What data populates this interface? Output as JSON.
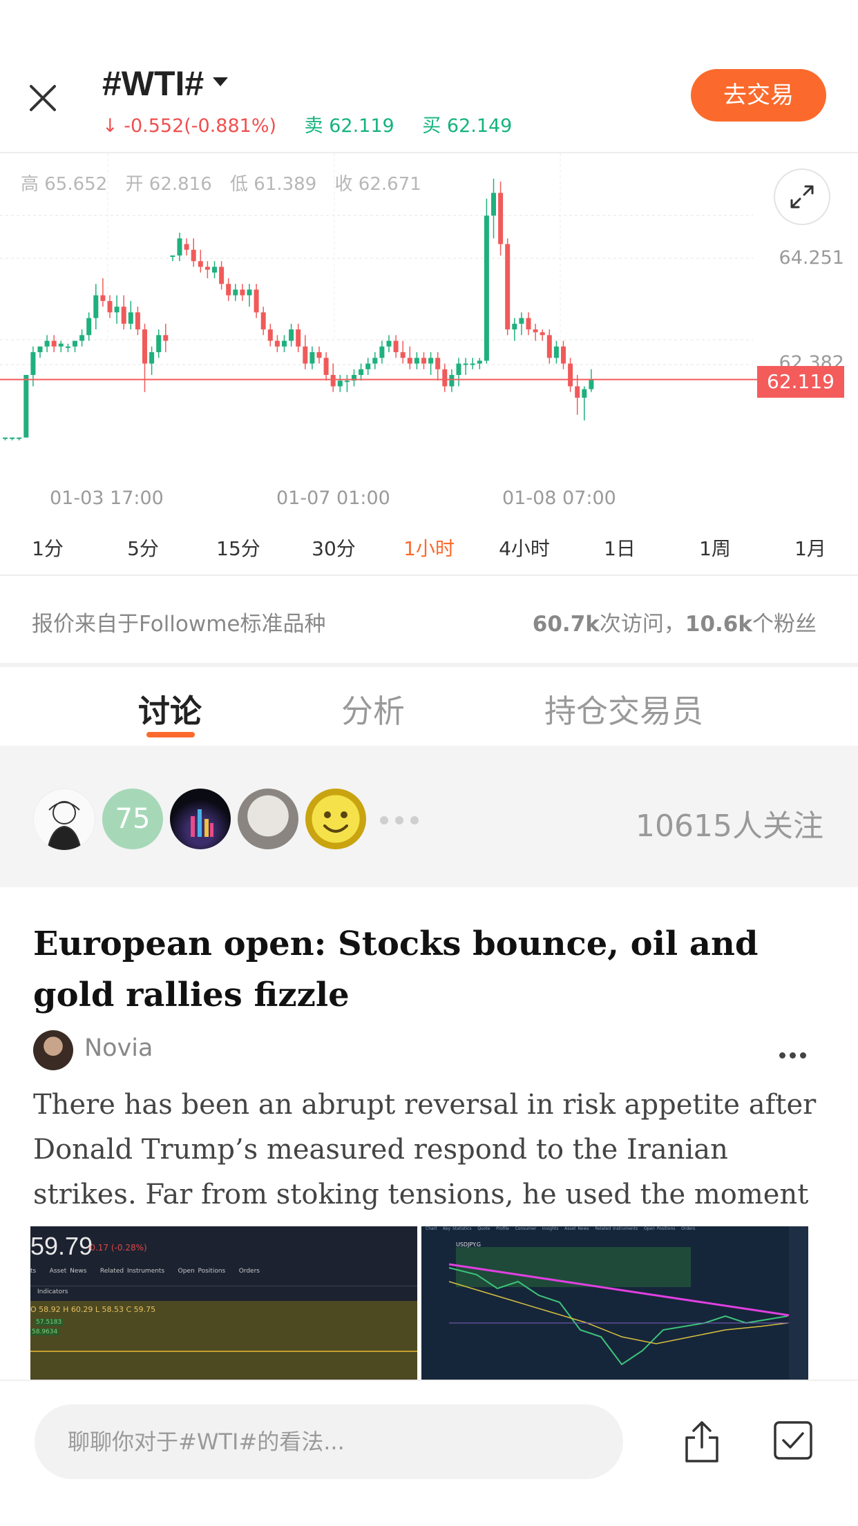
{
  "header": {
    "title": "#WTI#",
    "change": "-0.552(-0.881%)",
    "sell_label": "卖",
    "sell_price": "62.119",
    "buy_label": "买",
    "buy_price": "62.149",
    "trade_button": "去交易",
    "colors": {
      "down": "#f04f4f",
      "quote": "#14b37d",
      "accent": "#fb6a2c"
    }
  },
  "chart": {
    "ohlc": {
      "high": "高 65.652",
      "open": "开 62.816",
      "low": "低 61.389",
      "close": "收 62.671"
    },
    "price_labels": [
      "64.251",
      "62.382"
    ],
    "current_price": "62.119",
    "x_ticks": [
      "01-03 17:00",
      "01-07 01:00",
      "01-08 07:00"
    ]
  },
  "chart_data": {
    "type": "candlestick",
    "interval": "1小时",
    "y_ticks": [
      64.251,
      62.382
    ],
    "current_price": 62.119,
    "x_tick_labels": [
      "01-03 17:00",
      "01-07 01:00",
      "01-08 07:00"
    ],
    "candles": [
      [
        61.1,
        61.1,
        61.05,
        61.1
      ],
      [
        61.1,
        61.1,
        61.05,
        61.1
      ],
      [
        61.1,
        61.1,
        61.05,
        61.1
      ],
      [
        61.1,
        62.2,
        61.1,
        62.2
      ],
      [
        62.2,
        62.7,
        62.0,
        62.6
      ],
      [
        62.6,
        62.7,
        62.5,
        62.7
      ],
      [
        62.7,
        62.9,
        62.6,
        62.8
      ],
      [
        62.8,
        62.9,
        62.6,
        62.7
      ],
      [
        62.7,
        62.8,
        62.6,
        62.75
      ],
      [
        62.7,
        62.75,
        62.6,
        62.7
      ],
      [
        62.7,
        62.8,
        62.6,
        62.8
      ],
      [
        62.8,
        63.0,
        62.7,
        62.9
      ],
      [
        62.9,
        63.3,
        62.8,
        63.2
      ],
      [
        63.2,
        63.8,
        63.0,
        63.6
      ],
      [
        63.6,
        63.9,
        63.4,
        63.5
      ],
      [
        63.5,
        63.6,
        63.2,
        63.3
      ],
      [
        63.3,
        63.6,
        63.1,
        63.4
      ],
      [
        63.4,
        63.6,
        63.0,
        63.1
      ],
      [
        63.1,
        63.5,
        63.0,
        63.3
      ],
      [
        63.3,
        63.4,
        62.9,
        63.0
      ],
      [
        63.0,
        63.1,
        61.9,
        62.4
      ],
      [
        62.4,
        62.7,
        62.2,
        62.6
      ],
      [
        62.6,
        63.0,
        62.5,
        62.9
      ],
      [
        62.9,
        63.1,
        62.6,
        62.8
      ],
      [
        64.3,
        64.3,
        64.2,
        64.3
      ],
      [
        64.3,
        64.7,
        64.2,
        64.6
      ],
      [
        64.5,
        64.6,
        64.3,
        64.4
      ],
      [
        64.4,
        64.6,
        64.1,
        64.2
      ],
      [
        64.2,
        64.4,
        64.0,
        64.1
      ],
      [
        64.1,
        64.2,
        63.9,
        64.05
      ],
      [
        64.0,
        64.2,
        63.9,
        64.1
      ],
      [
        64.1,
        64.2,
        63.7,
        63.8
      ],
      [
        63.8,
        63.9,
        63.5,
        63.6
      ],
      [
        63.6,
        63.8,
        63.5,
        63.7
      ],
      [
        63.7,
        63.8,
        63.5,
        63.6
      ],
      [
        63.6,
        63.8,
        63.4,
        63.7
      ],
      [
        63.7,
        63.8,
        63.2,
        63.3
      ],
      [
        63.3,
        63.4,
        62.9,
        63.0
      ],
      [
        63.0,
        63.1,
        62.7,
        62.8
      ],
      [
        62.8,
        62.9,
        62.6,
        62.7
      ],
      [
        62.7,
        62.9,
        62.6,
        62.8
      ],
      [
        62.8,
        63.1,
        62.7,
        63.0
      ],
      [
        63.0,
        63.1,
        62.6,
        62.7
      ],
      [
        62.7,
        62.9,
        62.3,
        62.4
      ],
      [
        62.4,
        62.7,
        62.3,
        62.6
      ],
      [
        62.6,
        62.7,
        62.4,
        62.5
      ],
      [
        62.5,
        62.6,
        62.1,
        62.2
      ],
      [
        62.2,
        62.4,
        61.9,
        62.0
      ],
      [
        62.0,
        62.2,
        61.9,
        62.1
      ],
      [
        62.1,
        62.2,
        61.9,
        62.1
      ],
      [
        62.1,
        62.3,
        62.0,
        62.2
      ],
      [
        62.2,
        62.4,
        62.1,
        62.3
      ],
      [
        62.3,
        62.5,
        62.2,
        62.4
      ],
      [
        62.4,
        62.6,
        62.3,
        62.5
      ],
      [
        62.5,
        62.8,
        62.4,
        62.7
      ],
      [
        62.7,
        62.9,
        62.6,
        62.8
      ],
      [
        62.8,
        62.9,
        62.5,
        62.6
      ],
      [
        62.6,
        62.8,
        62.4,
        62.5
      ],
      [
        62.5,
        62.7,
        62.3,
        62.4
      ],
      [
        62.4,
        62.6,
        62.3,
        62.5
      ],
      [
        62.5,
        62.6,
        62.3,
        62.4
      ],
      [
        62.4,
        62.6,
        62.2,
        62.5
      ],
      [
        62.5,
        62.6,
        62.1,
        62.3
      ],
      [
        62.3,
        62.4,
        61.9,
        62.0
      ],
      [
        62.0,
        62.3,
        61.9,
        62.2
      ],
      [
        62.2,
        62.5,
        62.0,
        62.4
      ],
      [
        62.4,
        62.5,
        62.2,
        62.4
      ],
      [
        62.4,
        62.5,
        62.3,
        62.4
      ],
      [
        62.4,
        62.5,
        62.3,
        62.45
      ],
      [
        62.45,
        65.3,
        62.4,
        65.0
      ],
      [
        65.0,
        65.65,
        64.6,
        65.4
      ],
      [
        65.4,
        65.6,
        64.3,
        64.5
      ],
      [
        64.5,
        64.6,
        62.9,
        63.0
      ],
      [
        63.0,
        63.2,
        62.8,
        63.1
      ],
      [
        63.1,
        63.3,
        62.9,
        63.2
      ],
      [
        63.2,
        63.3,
        62.9,
        63.0
      ],
      [
        63.0,
        63.1,
        62.8,
        62.95
      ],
      [
        62.95,
        63.0,
        62.8,
        62.9
      ],
      [
        62.9,
        63.0,
        62.4,
        62.5
      ],
      [
        62.5,
        62.8,
        62.4,
        62.7
      ],
      [
        62.7,
        62.8,
        62.3,
        62.4
      ],
      [
        62.4,
        62.5,
        61.9,
        62.0
      ],
      [
        62.0,
        62.2,
        61.5,
        61.8
      ],
      [
        61.8,
        62.0,
        61.4,
        61.95
      ],
      [
        61.95,
        62.3,
        61.9,
        62.12
      ]
    ]
  },
  "timeframes": [
    "1分",
    "5分",
    "15分",
    "30分",
    "1小时",
    "4小时",
    "1日",
    "1周",
    "1月"
  ],
  "active_timeframe": "1小时",
  "info": {
    "source": "报价来自于Followme标准品种",
    "visits": "60.7k",
    "visits_suffix": "次访问，",
    "fans": "10.6k",
    "fans_suffix": "个粉丝"
  },
  "tabs": [
    "讨论",
    "分析",
    "持仓交易员"
  ],
  "followers": {
    "count_badge": "75",
    "count_text": "10615人关注"
  },
  "article": {
    "title": "European open: Stocks bounce, oil and gold rallies fizzle",
    "author": "Novia",
    "body": "There has been an abrupt reversal in risk appetite after Donald Trump’s measured respond to the Iranian strikes. Far from stoking tensions, he used the moment to step ...",
    "thumb1": {
      "price": "59.79",
      "change": "-0.17 (-0.28%)",
      "nav": [
        "ts",
        "Asset News",
        "Related Instruments",
        "Open Positions",
        "Orders"
      ],
      "indicators": "Indicators",
      "ohlc_line": "O 58.92  H 60.29  L 58.53  C 59.75",
      "levels": [
        "57.5183",
        "58.9634"
      ]
    },
    "thumb2": {
      "symbol": "USDJPY.G",
      "nav": [
        "Chart",
        "Key Statistics",
        "Quote",
        "Profile",
        "Consumer",
        "Insights",
        "Asset News",
        "Related Instruments",
        "Open Positions",
        "Orders"
      ]
    }
  },
  "bottom": {
    "placeholder": "聊聊你对于#WTI#的看法..."
  }
}
